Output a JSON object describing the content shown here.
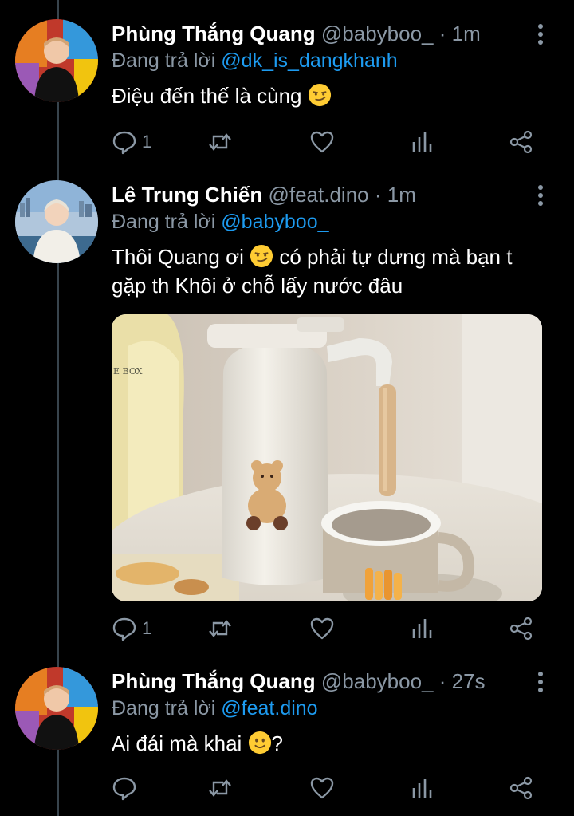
{
  "tweets": [
    {
      "name": "Phùng Thắng Quang",
      "handle": "@babyboo_",
      "separator": "·",
      "time": "1m",
      "replying_prefix": "Đang trả lời",
      "replying_to": "@dk_is_dangkhanh",
      "text_before_emoji": "Điệu đến thế là cùng ",
      "text_after_emoji": "",
      "text_line2": "",
      "emoji": "smirking-face",
      "reply_count": "1",
      "avatar": "avatar-quang"
    },
    {
      "name": "Lê Trung Chiến",
      "handle": "@feat.dino",
      "separator": "·",
      "time": "1m",
      "replying_prefix": "Đang trả lời",
      "replying_to": "@babyboo_",
      "text_before_emoji": "Thôi Quang ơi ",
      "text_after_emoji": " có phải tự dưng mà bạn t",
      "text_line2": "gặp th Khôi ở chỗ lấy nước đâu",
      "emoji": "smirking-face",
      "reply_count": "1",
      "avatar": "avatar-chien",
      "media": "photo-thermos-bear-mug"
    },
    {
      "name": "Phùng Thắng Quang",
      "handle": "@babyboo_",
      "separator": "·",
      "time": "27s",
      "replying_prefix": "Đang trả lời",
      "replying_to": "@feat.dino",
      "text_before_emoji": "Ai đái mà khai ",
      "text_after_emoji": "?",
      "text_line2": "",
      "emoji": "slightly-smiling-face",
      "reply_count": "",
      "avatar": "avatar-quang"
    }
  ],
  "colors": {
    "background": "#000000",
    "text": "#ffffff",
    "secondary": "#8b98a5",
    "link": "#1d9bf0",
    "thread_line": "#38444d"
  },
  "icons": {
    "reply": "comment-bubble-icon",
    "retweet": "retweet-arrows-icon",
    "like": "heart-icon",
    "analytics": "bar-chart-icon",
    "share": "share-nodes-icon",
    "more": "vertical-dots-icon"
  }
}
